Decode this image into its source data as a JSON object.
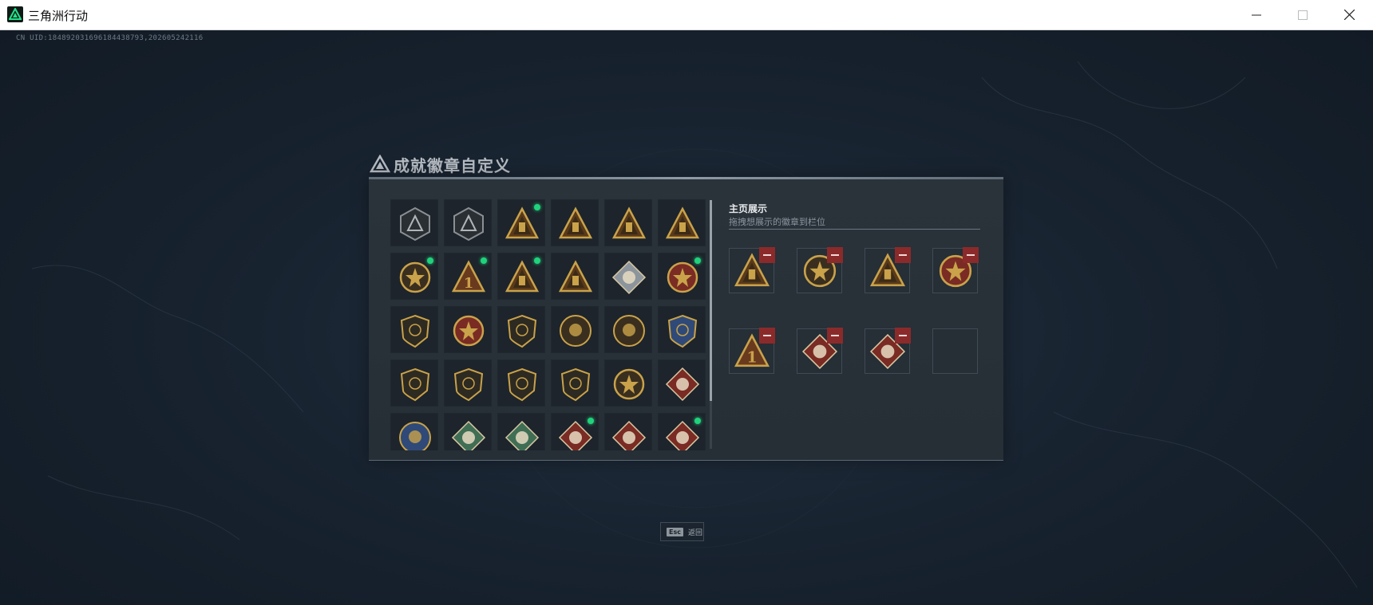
{
  "window": {
    "title": "三角洲行动"
  },
  "uid": "CN UID:1848920316961844387​93,202605242116",
  "dialog": {
    "title": "成就徽章自定义"
  },
  "badges": [
    {
      "icon": "delta-emblem-grey-badge-icon",
      "new": false
    },
    {
      "icon": "helicopter-grey-badge-icon",
      "new": false
    },
    {
      "icon": "gold-tower-triangle-badge-icon",
      "new": true
    },
    {
      "icon": "gold-hourglass-triangle-badge-icon",
      "new": false
    },
    {
      "icon": "gold-card-triangle-badge-icon",
      "new": false
    },
    {
      "icon": "gold-turret-triangle-badge-icon",
      "new": false
    },
    {
      "icon": "gold-skull-laurel-badge-icon",
      "new": true
    },
    {
      "icon": "gold-number-one-triangle-badge-icon",
      "new": true
    },
    {
      "icon": "gold-bottle-triangle-badge-icon",
      "new": true
    },
    {
      "icon": "gold-city-triangle-badge-icon",
      "new": false
    },
    {
      "icon": "silver-cube-diamond-badge-icon",
      "new": false
    },
    {
      "icon": "red-gold-star-medal-badge-icon",
      "new": true
    },
    {
      "icon": "gold-shield-wings-badge-icon",
      "new": false
    },
    {
      "icon": "gold-red-medal-badge-icon",
      "new": false
    },
    {
      "icon": "gold-shield-lion-badge-icon",
      "new": false
    },
    {
      "icon": "gold-circle-skull-badge-icon",
      "new": false
    },
    {
      "icon": "gold-circle-crest-badge-icon",
      "new": false
    },
    {
      "icon": "blue-shield-crossed-badge-icon",
      "new": false
    },
    {
      "icon": "gold-shield-rifle-badge-icon",
      "new": false
    },
    {
      "icon": "gold-shield-rifle-badge-icon",
      "new": false
    },
    {
      "icon": "gold-shield-sniper-badge-icon",
      "new": false
    },
    {
      "icon": "gold-shield-pistol-badge-icon",
      "new": false
    },
    {
      "icon": "gold-blue-crest-badge-icon",
      "new": false
    },
    {
      "icon": "red-diamond-beast-badge-icon",
      "new": false
    },
    {
      "icon": "blue-circle-dragon-badge-icon",
      "new": false
    },
    {
      "icon": "green-diamond-eagle-badge-icon",
      "new": false
    },
    {
      "icon": "green-diamond-wings-badge-icon",
      "new": false
    },
    {
      "icon": "red-diamond-dragon-badge-icon",
      "new": true
    },
    {
      "icon": "red-diamond-dragon-badge-icon",
      "new": false
    },
    {
      "icon": "red-diamond-runner-badge-icon",
      "new": true
    }
  ],
  "showcase": {
    "title": "主页展示",
    "subtitle": "拖拽想展示的徽章到栏位",
    "slots": [
      {
        "icon": "gold-bottle-triangle-badge-icon",
        "filled": true
      },
      {
        "icon": "gold-skull-laurel-badge-icon",
        "filled": true
      },
      {
        "icon": "gold-tower-triangle-badge-icon",
        "filled": true
      },
      {
        "icon": "red-gold-star-medal-badge-icon",
        "filled": true
      },
      {
        "icon": "gold-number-one-triangle-badge-icon",
        "filled": true
      },
      {
        "icon": "red-diamond-dragon-badge-icon",
        "filled": true
      },
      {
        "icon": "red-diamond-runner-badge-icon",
        "filled": true
      },
      {
        "icon": "",
        "filled": false
      }
    ]
  },
  "footer": {
    "esc_key": "Esc",
    "esc_label": "返回"
  },
  "colors": {
    "gold": "#c9a24a",
    "red_badge": "#7a2b23",
    "new_indicator": "#1fd37c",
    "remove_button": "#8b2a2a"
  }
}
